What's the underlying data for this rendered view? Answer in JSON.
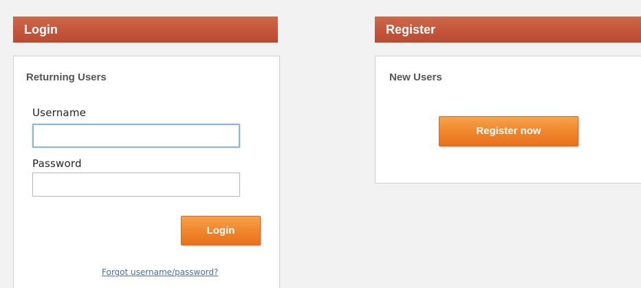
{
  "login": {
    "header": "Login",
    "subhead": "Returning Users",
    "username_label": "Username",
    "username_value": "",
    "password_label": "Password",
    "password_value": "",
    "button_label": "Login",
    "forgot_link": "Forgot username/password?"
  },
  "register": {
    "header": "Register",
    "subhead": "New Users",
    "button_label": "Register now"
  },
  "colors": {
    "header_bar": "#c4553a",
    "button_orange": "#f08a30",
    "page_bg": "#f2f2f2",
    "link": "#4a6fa5"
  }
}
